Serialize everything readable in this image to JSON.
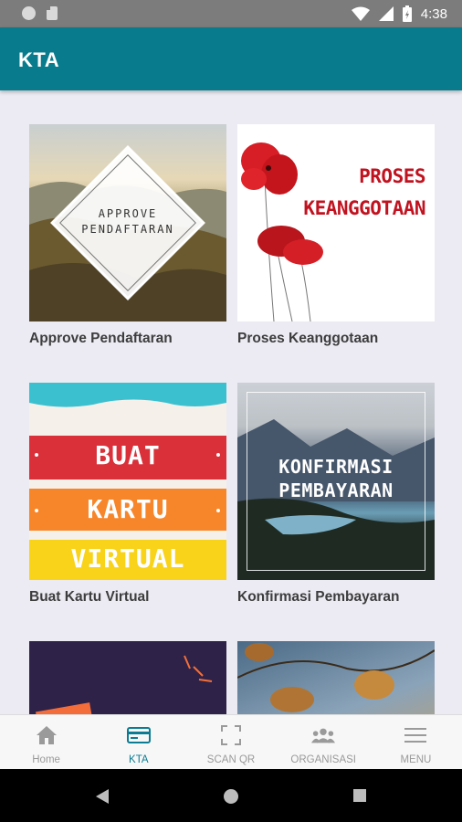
{
  "status_bar": {
    "time": "4:38",
    "icons": [
      "notification-circle-icon",
      "sd-card-icon",
      "wifi-icon",
      "signal-icon",
      "battery-icon"
    ]
  },
  "app_bar": {
    "title": "KTA",
    "color": "#087c8d"
  },
  "cards": [
    {
      "label": "Approve Pendaftaran",
      "image_text": [
        "APPROVE",
        "PENDAFTARAN"
      ]
    },
    {
      "label": "Proses Keanggotaan",
      "image_text": [
        "PROSES",
        "KEANGGOTAAN"
      ]
    },
    {
      "label": "Buat Kartu Virtual",
      "image_text": [
        "BUAT",
        "KARTU",
        "VIRTUAL"
      ]
    },
    {
      "label": "Konfirmasi Pembayaran",
      "image_text": [
        "KONFIRMASI",
        "PEMBAYARAN"
      ]
    },
    {
      "label": "",
      "image_text": []
    },
    {
      "label": "",
      "image_text": []
    }
  ],
  "bottom_nav": {
    "active": "KTA",
    "accent": "#0b7c93",
    "items": [
      {
        "label": "Home",
        "icon": "home-icon"
      },
      {
        "label": "KTA",
        "icon": "card-icon"
      },
      {
        "label": "SCAN QR",
        "icon": "scan-qr-icon"
      },
      {
        "label": "ORGANISASI",
        "icon": "group-icon"
      },
      {
        "label": "MENU",
        "icon": "menu-icon"
      }
    ]
  },
  "system_nav": [
    "back-icon",
    "home-circle-icon",
    "recents-icon"
  ]
}
